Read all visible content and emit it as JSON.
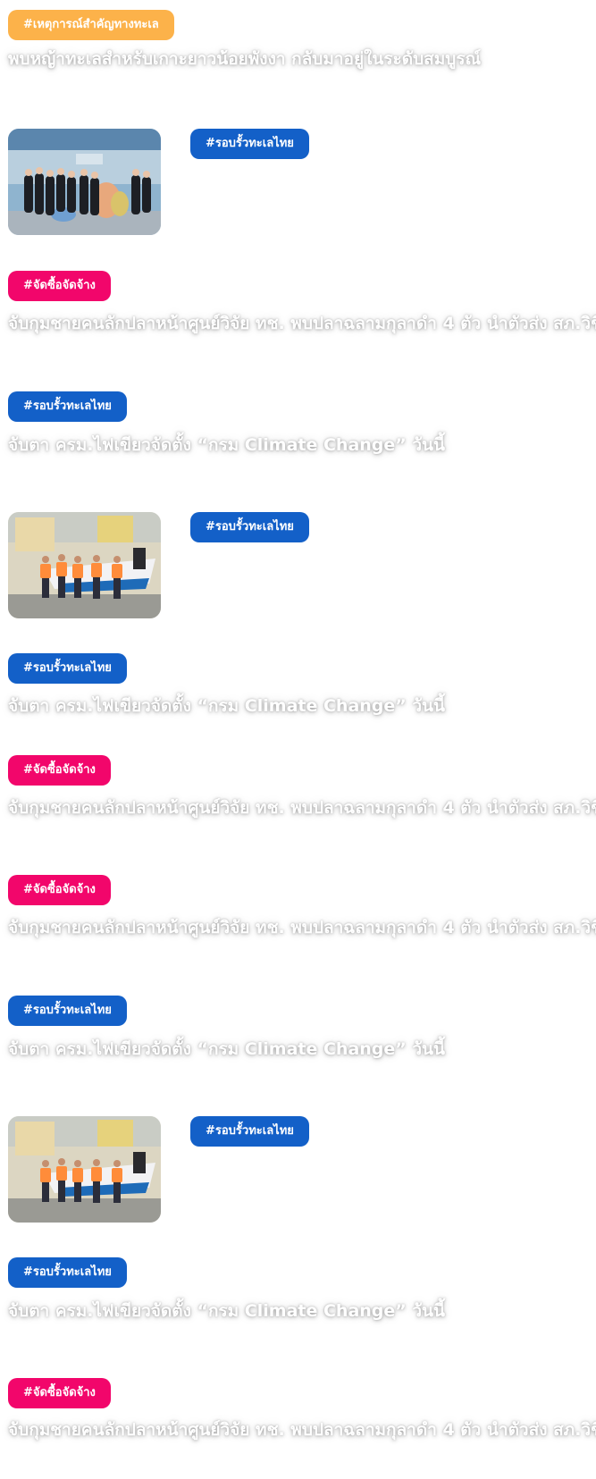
{
  "feed": {
    "item1": {
      "tag": "#เหตุการณ์สำคัญทางทะเล",
      "headline": "พบหญ้าทะเลสำหรับเกาะยาวน้อยพังงา กลับมาอยู่ในระดับสมบูรณ์"
    },
    "item2": {
      "tag": "#รอบรั้วทะเลไทย"
    },
    "item3": {
      "tag": "#จัดซื้อจัดจ้าง",
      "headline": "จับกุมชายคนลักปลาหน้าศูนย์วิจัย ทช. พบปลาฉลามกุลาดำ 4 ตัว นำตัวส่ง สภ.วิชิต"
    },
    "item4": {
      "tag": "#รอบรั้วทะเลไทย",
      "headline": "จับตา ครม.ไฟเขียวจัดตั้ง “กรม Climate Change” วันนี้"
    },
    "item5": {
      "tag": "#รอบรั้วทะเลไทย"
    },
    "item6": {
      "tag": "#รอบรั้วทะเลไทย",
      "headline": "จับตา ครม.ไฟเขียวจัดตั้ง “กรม Climate Change” วันนี้"
    },
    "item7": {
      "tag": "#จัดซื้อจัดจ้าง",
      "headline": "จับกุมชายคนลักปลาหน้าศูนย์วิจัย ทช. พบปลาฉลามกุลาดำ 4 ตัว นำตัวส่ง สภ.วิชิต"
    },
    "item8": {
      "tag": "#จัดซื้อจัดจ้าง",
      "headline": "จับกุมชายคนลักปลาหน้าศูนย์วิจัย ทช. พบปลาฉลามกุลาดำ 4 ตัว นำตัวส่ง สภ.วิชิต"
    },
    "item9": {
      "tag": "#รอบรั้วทะเลไทย",
      "headline": "จับตา ครม.ไฟเขียวจัดตั้ง “กรม Climate Change” วันนี้"
    },
    "item10": {
      "tag": "#รอบรั้วทะเลไทย"
    },
    "item11": {
      "tag": "#รอบรั้วทะเลไทย",
      "headline": "จับตา ครม.ไฟเขียวจัดตั้ง “กรม Climate Change” วันนี้"
    },
    "item12": {
      "tag": "#จัดซื้อจัดจ้าง",
      "headline": "จับกุมชายคนลักปลาหน้าศูนย์วิจัย ทช. พบปลาฉลามกุลาดำ 4 ตัว นำตัวส่ง สภ.วิชิต"
    }
  },
  "colors": {
    "tag_orange": "#fcb24a",
    "tag_blue": "#1360c8",
    "tag_pink": "#f2066b",
    "headline_text": "#ffffff",
    "page_background": "#ffffff"
  },
  "images": {
    "group_photo": "group-photo-event",
    "boat_team_photo": "team-with-boat-photo"
  }
}
